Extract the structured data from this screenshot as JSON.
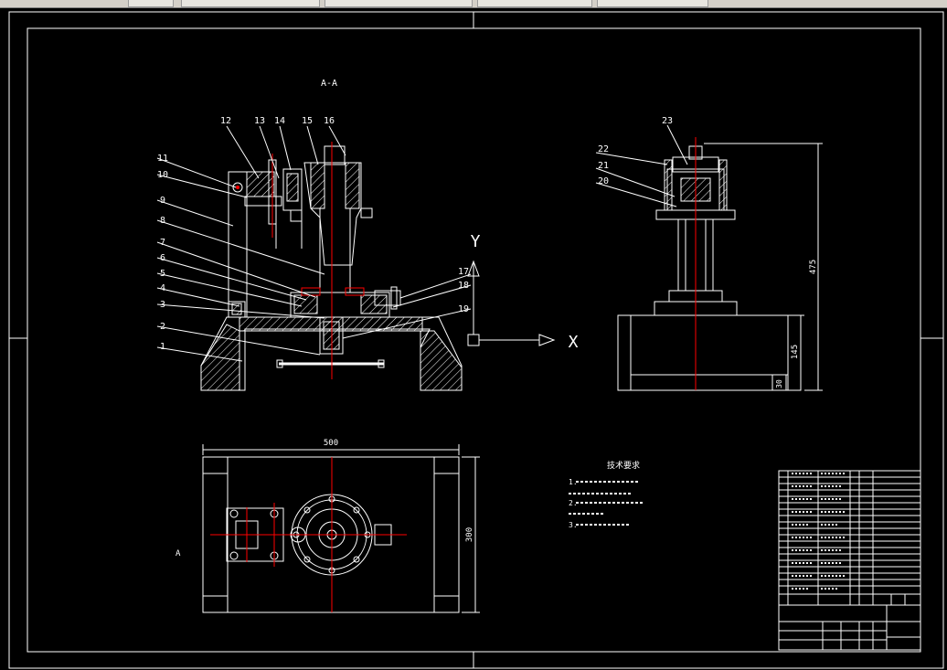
{
  "colors": {
    "background": "#000000",
    "line": "#ffffff",
    "centerline": "#ff0000",
    "toolbar": "#d4d0c8"
  },
  "section_label": "A-A",
  "view_label_bottom": "A",
  "axes": {
    "y": "Y",
    "x": "X"
  },
  "balloons": [
    "1",
    "2",
    "3",
    "4",
    "5",
    "6",
    "7",
    "8",
    "9",
    "10",
    "11",
    "12",
    "13",
    "14",
    "15",
    "16",
    "17",
    "18",
    "19",
    "20",
    "21",
    "22",
    "23"
  ],
  "dimensions": {
    "width_500": "500",
    "height_300": "300",
    "height_475": "475",
    "height_145": "145",
    "base_30": "30"
  },
  "notes_title": "技术要求",
  "notes": [
    "1.",
    "2.",
    "3."
  ]
}
